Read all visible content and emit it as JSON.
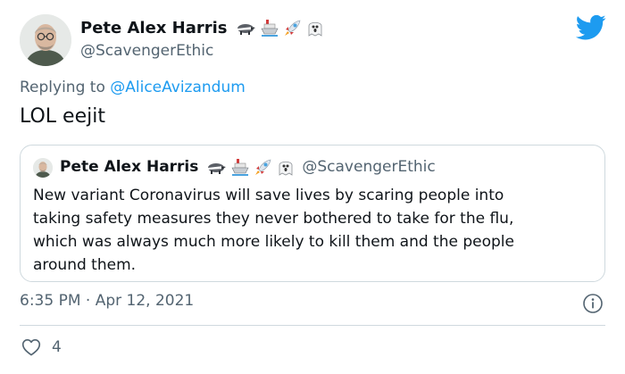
{
  "author": {
    "name": "Pete Alex Harris",
    "handle": "@ScavengerEthic",
    "emoji_icons": [
      "badger-icon",
      "ship-icon",
      "rocket-icon",
      "ghost-icon"
    ]
  },
  "reply": {
    "prefix": "Replying to",
    "mention": "@AliceAvizandum"
  },
  "tweet": {
    "text": "LOL eejit",
    "timestamp": "6:35 PM · Apr 12, 2021",
    "likes": "4"
  },
  "quoted": {
    "name": "Pete Alex Harris",
    "handle": "@ScavengerEthic",
    "lines": [
      "New variant Coronavirus will save lives by scaring people into",
      "taking safety measures they never bothered to take for the flu,",
      "which was always much more likely to kill them and the people",
      "around them."
    ]
  },
  "colors": {
    "twitter_blue": "#1d9bf0",
    "text_primary": "#0f1419",
    "text_secondary": "#536471",
    "border": "#cfd9de"
  },
  "icons": {
    "brand": "twitter-bird-icon",
    "info": "info-icon",
    "like": "heart-outline-icon"
  }
}
